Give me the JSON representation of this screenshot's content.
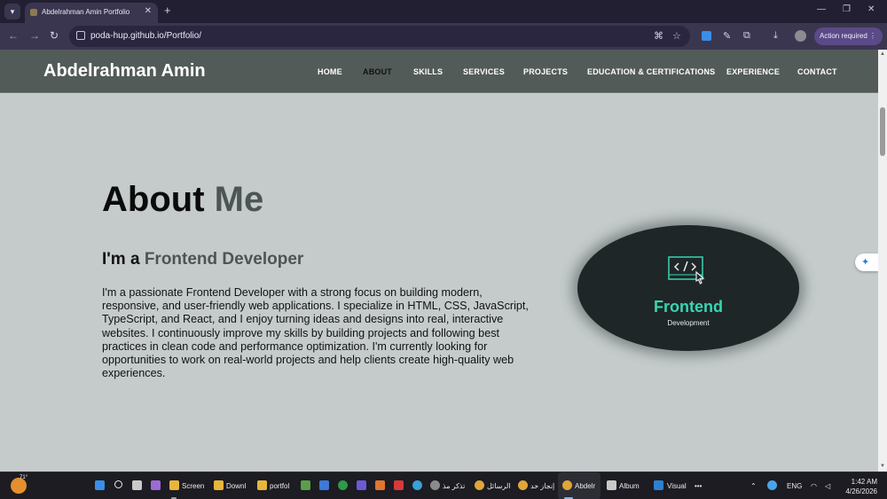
{
  "browser": {
    "tab_title": "Abdelrahman Amin Portfolio",
    "url": "poda-hup.github.io/Portfolio/",
    "action_required": "Action required",
    "new_tab": "+",
    "tab_close": "✕",
    "minimize": "—",
    "restore": "❐",
    "close": "✕"
  },
  "site": {
    "brand": "Abdelrahman Amin",
    "nav": [
      "HOME",
      "ABOUT",
      "SKILLS",
      "SERVICES",
      "PROJECTS",
      "EDUCATION & CERTIFICATIONS",
      "EXPERIENCE",
      "CONTACT"
    ],
    "active_nav": "ABOUT"
  },
  "about": {
    "title_main": "About",
    "title_accent": "Me",
    "subtitle_main": "I'm a",
    "subtitle_accent": "Frontend Developer",
    "paragraph": "I'm a passionate Frontend Developer with a strong focus on building modern, responsive, and user-friendly web applications. I specialize in HTML, CSS, JavaScript, TypeScript, and React, and I enjoy turning ideas and designs into real, interactive websites. I continuously improve my skills by building projects and following best practices in clean code and performance optimization. I'm currently looking for opportunities to work on real-world projects and help clients create high-quality web experiences.",
    "image_heading": "Frontend",
    "image_sub": "Development"
  },
  "taskbar": {
    "weather_temp": "71°",
    "items": [
      {
        "label": "Screen",
        "icon": "folder-icon"
      },
      {
        "label": "Downl",
        "icon": "folder-icon"
      },
      {
        "label": "portfol",
        "icon": "folder-icon"
      },
      {
        "label": "تذكر مذ",
        "icon": "app-icon"
      },
      {
        "label": "الرسائل",
        "icon": "chrome-icon"
      },
      {
        "label": "إنجاز خد",
        "icon": "chrome-icon"
      },
      {
        "label": "Abdelr",
        "icon": "chrome-icon"
      },
      {
        "label": "Album",
        "icon": "album-icon"
      },
      {
        "label": "Visual",
        "icon": "vscode-icon"
      }
    ],
    "language": "ENG",
    "time": "1:42 AM",
    "date": "4/26/2026",
    "more": "•••"
  },
  "colors": {
    "accent_teal": "#37d6b2",
    "header_bg": "#535b59",
    "page_bg": "#c5cbcb"
  }
}
